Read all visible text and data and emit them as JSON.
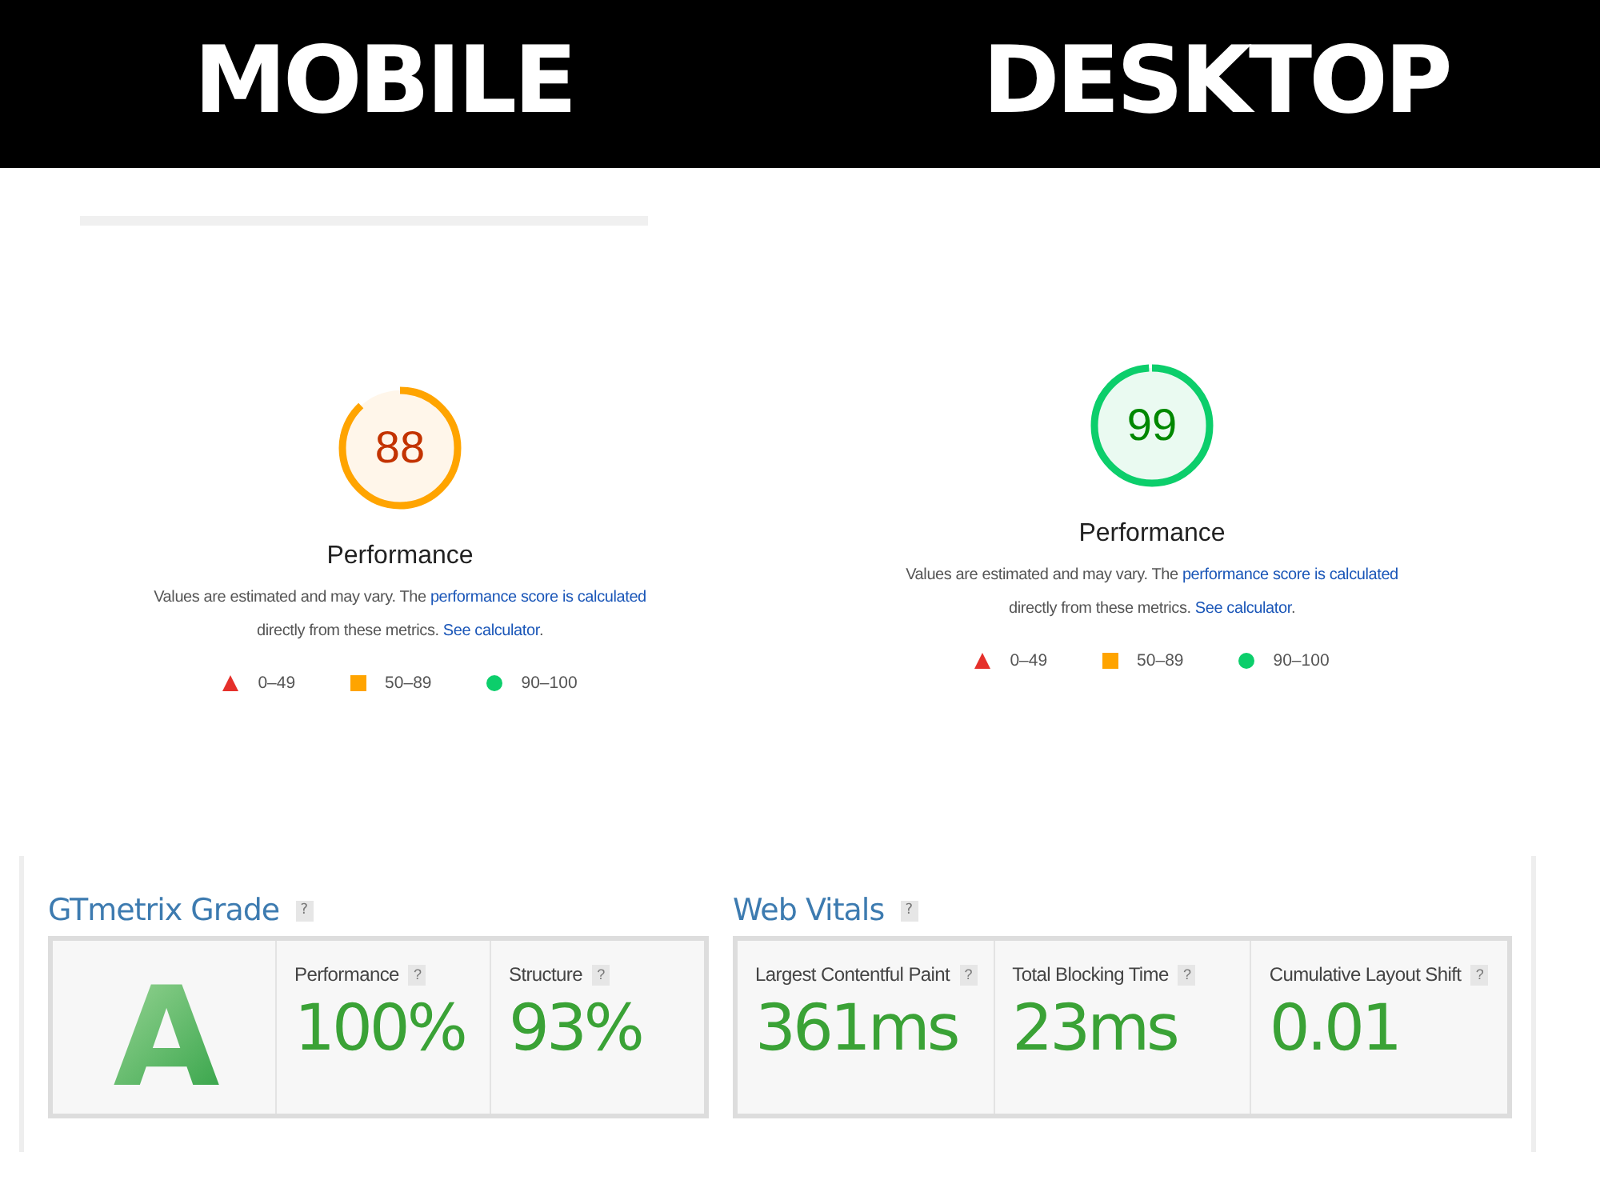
{
  "header": {
    "columns": [
      {
        "label": "MOBILE"
      },
      {
        "label": "DESKTOP"
      }
    ]
  },
  "lighthouse": [
    {
      "score": "88",
      "level": 0.88,
      "kind": "average",
      "title": "Performance",
      "note": [
        {
          "kind": "text",
          "text": "Values are estimated and may vary. The "
        },
        {
          "kind": "link",
          "text": "performance score is calculated"
        },
        {
          "kind": "text",
          "text": " directly from these metrics. "
        },
        {
          "kind": "link",
          "text": "See calculator"
        },
        {
          "kind": "text",
          "text": "."
        }
      ],
      "legend": [
        {
          "kind": "fail",
          "range": "0–49"
        },
        {
          "kind": "average",
          "range": "50–89"
        },
        {
          "kind": "pass",
          "range": "90–100"
        }
      ]
    },
    {
      "score": "99",
      "level": 0.99,
      "kind": "good",
      "title": "Performance",
      "note": [
        {
          "kind": "text",
          "text": "Values are estimated and may vary. The "
        },
        {
          "kind": "link",
          "text": "performance score is calculated"
        },
        {
          "kind": "text",
          "text": " directly from these metrics. "
        },
        {
          "kind": "link",
          "text": "See calculator"
        },
        {
          "kind": "text",
          "text": "."
        }
      ],
      "legend": [
        {
          "kind": "fail",
          "range": "0–49"
        },
        {
          "kind": "average",
          "range": "50–89"
        },
        {
          "kind": "pass",
          "range": "90–100"
        }
      ]
    }
  ],
  "gtmetrix": [
    {
      "title": "GTmetrix Grade",
      "help": "?",
      "grade": "A",
      "metrics": [
        {
          "label": "Performance",
          "help": "?",
          "value": "100%"
        },
        {
          "label": "Structure",
          "help": "?",
          "value": "93%"
        }
      ]
    },
    {
      "title": "Web Vitals",
      "help": "?",
      "metrics": [
        {
          "label": "Largest Contentful Paint",
          "help": "?",
          "value": "361ms"
        },
        {
          "label": "Total Blocking Time",
          "help": "?",
          "value": "23ms"
        },
        {
          "label": "Cumulative Layout Shift",
          "help": "?",
          "value": "0.01"
        }
      ]
    }
  ]
}
